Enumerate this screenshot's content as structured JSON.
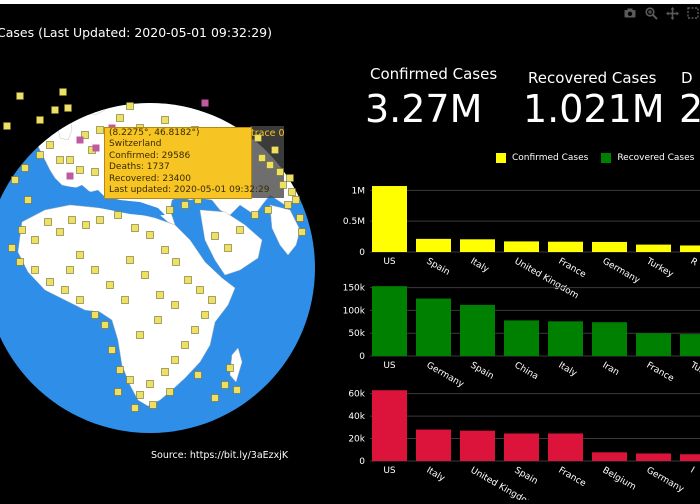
{
  "title": "Cases (Last Updated: 2020-05-01 09:32:29)",
  "toolbar": {
    "icons": [
      "camera-icon",
      "zoom-icon",
      "pan-icon",
      "box-select-icon"
    ]
  },
  "map": {
    "tooltip": {
      "coords": "(8.2275°, 46.8182°)",
      "country": "Switzerland",
      "confirmed": "Confirmed: 29586",
      "deaths": "Deaths: 1737",
      "recovered": "Recovered: 23400",
      "updated": "Last updated: 2020-05-01 09:32:29"
    },
    "trace_label": "trace 0",
    "source": "Source: https://bit.ly/3aEzxjK"
  },
  "kpis": {
    "confirmed": {
      "label": "Confirmed Cases",
      "value": "3.27M"
    },
    "recovered": {
      "label": "Recovered Cases",
      "value": "1.021M"
    },
    "deaths": {
      "label": "D",
      "value": "2"
    }
  },
  "legend": {
    "confirmed": "Confirmed Cases",
    "recovered": "Recovered Cases"
  },
  "colors": {
    "confirmed": "#ffff00",
    "recovered": "#008000",
    "deaths": "#dc143c",
    "ocean": "#2f8fe8",
    "land": "#ffffff",
    "marker": "#f0e060",
    "tooltip": "#f6c523"
  },
  "chart_data": [
    {
      "type": "bar",
      "name": "confirmed",
      "categories": [
        "US",
        "Spain",
        "Italy",
        "United Kingdom",
        "France",
        "Germany",
        "Turkey",
        "R"
      ],
      "values": [
        1070000,
        213000,
        206000,
        172000,
        167000,
        163000,
        120000,
        106000
      ],
      "ylim": [
        0,
        1200000
      ],
      "yticks": [
        "0",
        "0.5M",
        "1M"
      ],
      "color": "#ffff00"
    },
    {
      "type": "bar",
      "name": "recovered",
      "categories": [
        "US",
        "Germany",
        "Spain",
        "China",
        "Italy",
        "Iran",
        "France",
        "Turk"
      ],
      "values": [
        153000,
        126000,
        112000,
        78000,
        76000,
        74000,
        50000,
        48000
      ],
      "ylim": [
        0,
        160000
      ],
      "yticks": [
        "0",
        "50k",
        "100k",
        "150k"
      ],
      "color": "#008000"
    },
    {
      "type": "bar",
      "name": "deaths",
      "categories": [
        "US",
        "Italy",
        "United Kingdom",
        "Spain",
        "France",
        "Belgium",
        "Germany",
        "I"
      ],
      "values": [
        63000,
        28000,
        27000,
        24500,
        24500,
        7700,
        6700,
        6000
      ],
      "ylim": [
        0,
        65000
      ],
      "yticks": [
        "0",
        "20k",
        "40k",
        "60k"
      ],
      "color": "#dc143c"
    }
  ]
}
